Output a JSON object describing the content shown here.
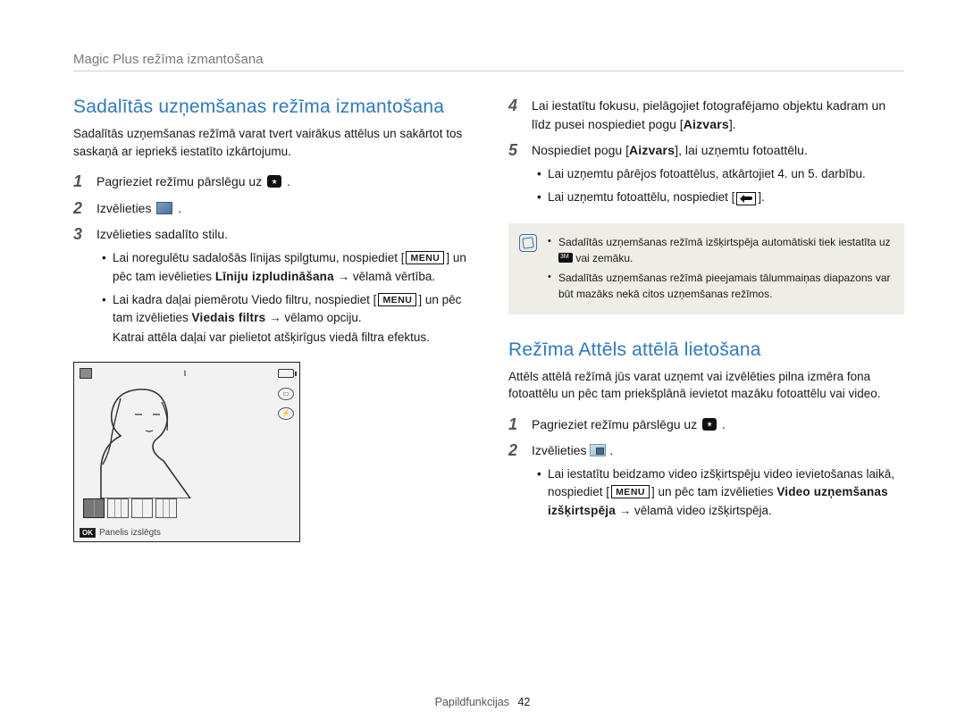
{
  "breadcrumb": "Magic Plus režīma izmantošana",
  "left": {
    "heading": "Sadalītās uzņemšanas režīma izmantošana",
    "intro": "Sadalītās uzņemšanas režīmā varat tvert vairākus attēlus un sakārtot tos saskaņā ar iepriekš iestatīto izkārtojumu.",
    "step1": "Pagrieziet režīmu pārslēgu uz ",
    "step1_end": ".",
    "step2": "Izvēlieties ",
    "step2_end": ".",
    "step3": "Izvēlieties sadalīto stilu.",
    "sub3a_pre": "Lai noregulētu sadalošās līnijas spilgtumu, nospiediet [",
    "sub3a_mid": "] un pēc tam ievēlieties ",
    "sub3a_bold": "Līniju izpludināšana",
    "sub3a_post": " → vēlamā vērtība.",
    "sub3b_pre": "Lai kadra daļai piemērotu Viedo filtru, nospiediet [",
    "sub3b_mid": "] un pēc tam izvēlieties ",
    "sub3b_bold": "Viedais filtrs",
    "sub3b_post": " → vēlamo opciju.",
    "sub3b_note": "Katrai attēla daļai var pielietot atšķirīgus viedā filtra efektus.",
    "preview_caption": "Panelis izslēgts"
  },
  "right": {
    "step4_pre": "Lai iestatītu fokusu, pielāgojiet fotografējamo objektu kadram un līdz pusei nospiediet pogu [",
    "step4_bold": "Aizvars",
    "step4_post": "].",
    "step5_pre": "Nospiediet pogu [",
    "step5_bold": "Aizvars",
    "step5_post": "], lai uzņemtu fotoattēlu.",
    "sub5a": "Lai uzņemtu pārējos fotoattēlus, atkārtojiet 4. un 5. darbību.",
    "sub5b_pre": "Lai uzņemtu fotoattēlu, nospiediet [",
    "sub5b_post": "].",
    "note1_pre": "Sadalītās uzņemšanas režīmā izšķirtspēja automātiski tiek iestatīta uz ",
    "note1_post": " vai zemāku.",
    "note2": "Sadalītās uzņemšanas režīmā pieejamais tālummaiņas diapazons var būt mazāks nekā citos uzņemšanas režīmos.",
    "heading2": "Režīma Attēls attēlā lietošana",
    "intro2": "Attēls attēlā režīmā jūs varat uzņemt vai izvēlēties pilna izmēra fona fotoattēlu un pēc tam priekšplānā ievietot mazāku fotoattēlu vai video.",
    "r_step1": "Pagrieziet režīmu pārslēgu uz ",
    "r_step1_end": ".",
    "r_step2": "Izvēlieties ",
    "r_step2_end": ".",
    "r_sub2_pre": "Lai iestatītu beidzamo video izšķirtspēju video ievietošanas laikā, nospiediet [",
    "r_sub2_mid": "] un pēc tam izvēlieties ",
    "r_sub2_bold": "Video uzņemšanas izšķirtspēja",
    "r_sub2_post": " → vēlamā video izšķirtspēja."
  },
  "footer": {
    "section": "Papildfunkcijas",
    "page": "42"
  },
  "icons": {
    "menu_label": "MENU",
    "ok_label": "OK"
  }
}
